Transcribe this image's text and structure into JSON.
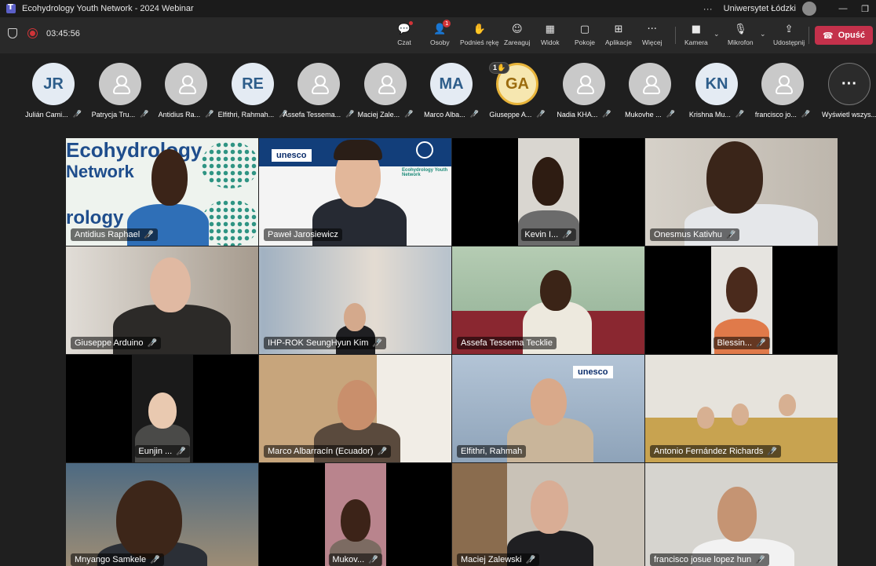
{
  "window": {
    "title": "Ecohydrology Youth Network - 2024 Webinar",
    "org": "Uniwersytet Łódzki",
    "more": "···",
    "minimize": "—",
    "restore": "❐"
  },
  "toolbar": {
    "timer": "03:45:56",
    "chat": "Czat",
    "people": "Osoby",
    "people_badge": "1",
    "raise_hand": "Podnieś rękę",
    "react": "Zareaguj",
    "view": "Widok",
    "rooms": "Pokoje",
    "apps": "Aplikacje",
    "more": "Więcej",
    "camera": "Kamera",
    "mic": "Mikrofon",
    "share": "Udostępnij",
    "leave": "Opuść"
  },
  "participants": [
    {
      "name": "Julián Cami...",
      "initials": "JR",
      "style": "initials"
    },
    {
      "name": "Patrycja Tru...",
      "initials": "",
      "style": "gray"
    },
    {
      "name": "Antidius Ra...",
      "initials": "",
      "style": "gray"
    },
    {
      "name": "Elfithri, Rahmah...",
      "initials": "RE",
      "style": "initials"
    },
    {
      "name": "Assefa Tessema...",
      "initials": "",
      "style": "gray"
    },
    {
      "name": "Maciej Zale...",
      "initials": "",
      "style": "gray"
    },
    {
      "name": "Marco Alba...",
      "initials": "MA",
      "style": "initials"
    },
    {
      "name": "Giuseppe A...",
      "initials": "GA",
      "style": "gold",
      "hand": "1✋"
    },
    {
      "name": "Nadia KHA...",
      "initials": "",
      "style": "gray"
    },
    {
      "name": "Mukovhe ...",
      "initials": "",
      "style": "gray"
    },
    {
      "name": "Krishna Mu...",
      "initials": "KN",
      "style": "initials"
    },
    {
      "name": "francisco jo...",
      "initials": "",
      "style": "gray"
    },
    {
      "name": "Wyświetl wszys...",
      "initials": "···",
      "style": "more"
    }
  ],
  "tiles": [
    {
      "name": "Antidius Raphael"
    },
    {
      "name": "Paweł Jarosiewicz"
    },
    {
      "name": "Kevin I..."
    },
    {
      "name": "Onesmus Kativhu"
    },
    {
      "name": "Giuseppe Arduino"
    },
    {
      "name": "IHP-ROK SeungHyun Kim"
    },
    {
      "name": "Assefa Tessema Tecklie"
    },
    {
      "name": "Blessin..."
    },
    {
      "name": "Eunjin ..."
    },
    {
      "name": "Marco Albarracín (Ecuador)"
    },
    {
      "name": "Elfithri, Rahmah"
    },
    {
      "name": "Antonio Fernández Richards"
    },
    {
      "name": "Mnyango Samkele"
    },
    {
      "name": "Mukov..."
    },
    {
      "name": "Maciej Zalewski"
    },
    {
      "name": "francisco josue lopez hun"
    }
  ],
  "backgrounds": {
    "ecohydrology_text": "Ecohydrology",
    "network_text": "Network",
    "rology_text": "rology",
    "unesco": "unesco",
    "eyn_logo": "Ecohydrology Youth Network"
  },
  "icons": {
    "mic_off": "mic-off-icon"
  }
}
